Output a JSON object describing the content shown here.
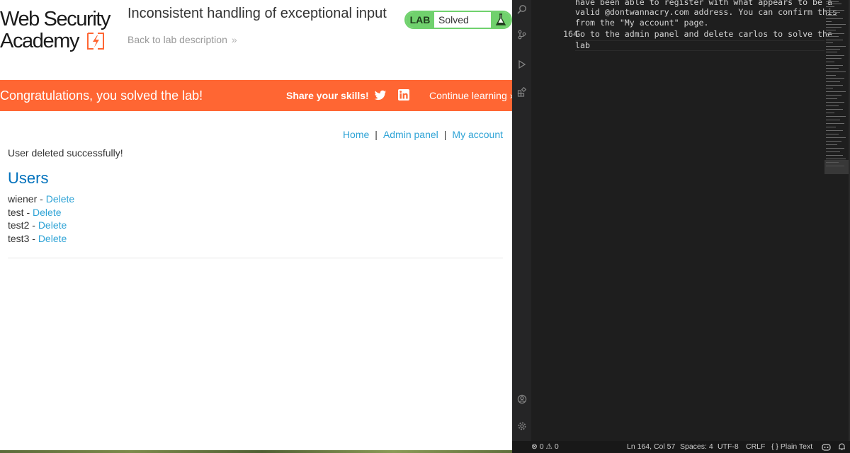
{
  "browser": {
    "logo": {
      "line1": "Web Security",
      "line2": "Academy"
    },
    "lab_title": "Inconsistent handling of exceptional input",
    "back_link": "Back to lab description",
    "back_chevron": "»",
    "lab_status": {
      "tag": "LAB",
      "state": "Solved"
    },
    "banner": {
      "message": "Congratulations, you solved the lab!",
      "share": "Share your skills!",
      "continue": "Continue learning",
      "continue_chevron": "»"
    },
    "nav": {
      "home": "Home",
      "separator": "|",
      "admin_panel": "Admin panel",
      "my_account": "My account"
    },
    "flash": "User deleted successfully!",
    "users_heading": "Users",
    "users": [
      {
        "name": "wiener",
        "sep": " - ",
        "action": "Delete"
      },
      {
        "name": "test",
        "sep": " - ",
        "action": "Delete"
      },
      {
        "name": "test2",
        "sep": " - ",
        "action": "Delete"
      },
      {
        "name": "test3",
        "sep": " - ",
        "action": "Delete"
      }
    ],
    "colors": {
      "brand_orange": "#ff6633",
      "lab_green": "#70d16d",
      "link_blue": "#2ea3d6",
      "heading_blue": "#0071bc"
    }
  },
  "editor": {
    "lines": [
      {
        "num": "",
        "text": "have been able to register with what appears to be a"
      },
      {
        "num": "",
        "text": "valid @dontwannacry.com address. You can confirm this"
      },
      {
        "num": "",
        "text": "from the \"My account\" page."
      },
      {
        "num": "164",
        "text": "Go to the admin panel and delete carlos to solve the"
      },
      {
        "num": "",
        "text": "lab"
      }
    ],
    "icons": [
      "search-icon",
      "run-debug-icon",
      "extensions-icon",
      "accounts-icon",
      "settings-gear-icon"
    ],
    "status_bar": {
      "errors": "0",
      "warnings": "0",
      "position": "Ln 164, Col 57",
      "spaces": "Spaces: 4",
      "encoding": "UTF-8",
      "eol": "CRLF",
      "language_braces": "{ }",
      "language": "Plain Text"
    }
  }
}
